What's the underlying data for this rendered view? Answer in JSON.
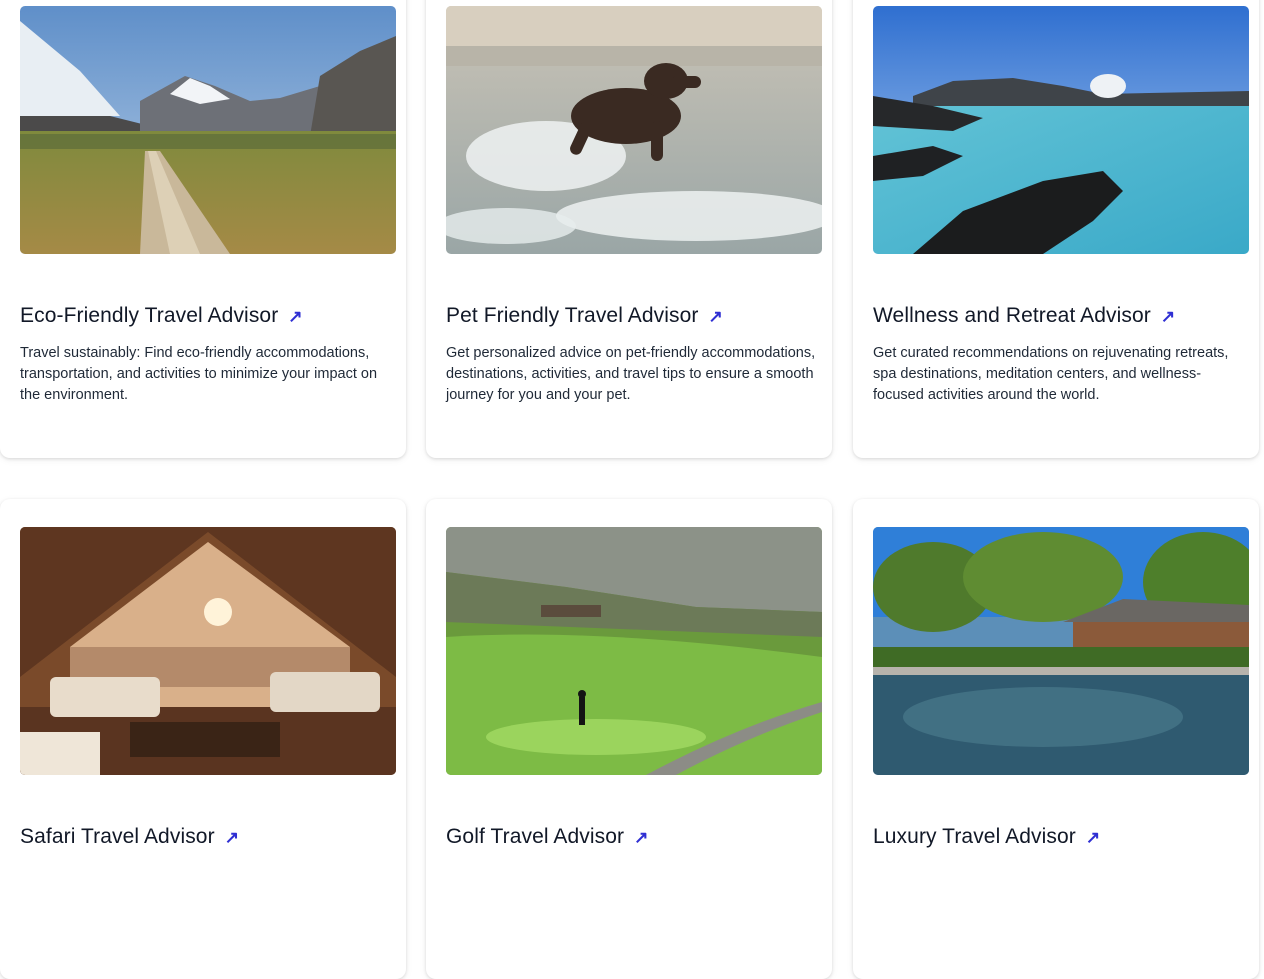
{
  "cards": [
    {
      "title": "Eco-Friendly Travel Advisor",
      "description": "Travel sustainably: Find eco-friendly accommodations, transportation, and activities to minimize your impact on the environment.",
      "arrow": "↗",
      "image": "mountain-boardwalk-image"
    },
    {
      "title": "Pet Friendly Travel Advisor",
      "description": "Get personalized advice on pet-friendly accommodations, destinations, activities, and travel tips to ensure a smooth journey for you and your pet.",
      "arrow": "↗",
      "image": "dog-running-in-surf-image"
    },
    {
      "title": "Wellness and Retreat Advisor",
      "description": "Get curated recommendations on rejuvenating retreats, spa destinations, meditation centers, and wellness-focused activities around the world.",
      "arrow": "↗",
      "image": "blue-lagoon-image"
    },
    {
      "title": "Safari Travel Advisor",
      "description": "",
      "arrow": "↗",
      "image": "safari-lodge-interior-image"
    },
    {
      "title": "Golf Travel Advisor",
      "description": "",
      "arrow": "↗",
      "image": "golf-course-image"
    },
    {
      "title": "Luxury Travel Advisor",
      "description": "",
      "arrow": "↗",
      "image": "luxury-villa-pool-image"
    }
  ]
}
